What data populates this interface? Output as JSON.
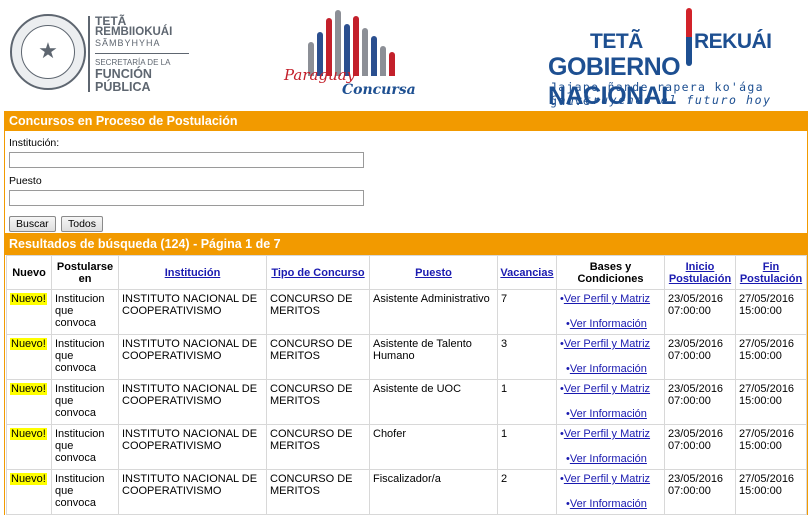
{
  "header": {
    "sfp": {
      "line1": "TETÃ",
      "line2": "REMBIIOKUÁI",
      "line3": "SÃMBYHYHA",
      "line4a": "SECRETARÍA DE LA",
      "line5": "FUNCIÓN",
      "line6": "PÚBLICA"
    },
    "concursa": {
      "word1": "Paraguay",
      "word2": "Concursa"
    },
    "gobierno": {
      "line1a": "TETÃ",
      "line1b": "REKUÁI",
      "line2": "GOBIERNO NACIONAL",
      "line3": "Jajapo ñande rapera ko'ága guive",
      "line4": "Construyendo el futuro hoy"
    },
    "colors": {
      "orange": "#f29a00",
      "red": "#d2232a",
      "blue": "#1d4f91",
      "gray": "#5e6670"
    }
  },
  "search": {
    "title": "Concursos en Proceso de Postulación",
    "institucion_label": "Institución:",
    "institucion_value": "",
    "puesto_label": "Puesto",
    "puesto_value": "",
    "buscar_label": "Buscar",
    "todos_label": "Todos"
  },
  "results": {
    "title": "Resultados de búsqueda (124) - Página 1 de 7",
    "columns": {
      "nuevo": "Nuevo",
      "postularse": "Postularse en",
      "institucion": "Institución",
      "tipo": "Tipo de Concurso",
      "puesto": "Puesto",
      "vacancias": "Vacancias",
      "bases": "Bases y Condiciones",
      "inicio": "Inicio Postulación",
      "fin": "Fin Postulación"
    },
    "rows": [
      {
        "nuevo": "Nuevo!",
        "postularse": "Institucion que convoca",
        "institucion": "INSTITUTO NACIONAL DE COOPERATIVISMO",
        "tipo": "CONCURSO DE MERITOS",
        "puesto": "Asistente Administrativo",
        "vacancias": "7",
        "link1": "Ver Perfil y Matriz",
        "link2": "Ver Información",
        "inicio": "23/05/2016 07:00:00",
        "fin": "27/05/2016 15:00:00"
      },
      {
        "nuevo": "Nuevo!",
        "postularse": "Institucion que convoca",
        "institucion": "INSTITUTO NACIONAL DE COOPERATIVISMO",
        "tipo": "CONCURSO DE MERITOS",
        "puesto": "Asistente de Talento Humano",
        "vacancias": "3",
        "link1": "Ver Perfil y Matriz",
        "link2": "Ver Información",
        "inicio": "23/05/2016 07:00:00",
        "fin": "27/05/2016 15:00:00"
      },
      {
        "nuevo": "Nuevo!",
        "postularse": "Institucion que convoca",
        "institucion": "INSTITUTO NACIONAL DE COOPERATIVISMO",
        "tipo": "CONCURSO DE MERITOS",
        "puesto": "Asistente de UOC",
        "vacancias": "1",
        "link1": "Ver Perfil y Matriz",
        "link2": "Ver Información",
        "inicio": "23/05/2016 07:00:00",
        "fin": "27/05/2016 15:00:00"
      },
      {
        "nuevo": "Nuevo!",
        "postularse": "Institucion que convoca",
        "institucion": "INSTITUTO NACIONAL DE COOPERATIVISMO",
        "tipo": "CONCURSO DE MERITOS",
        "puesto": "Chofer",
        "vacancias": "1",
        "link1": "Ver Perfil y Matriz",
        "link2": "Ver Información",
        "inicio": "23/05/2016 07:00:00",
        "fin": "27/05/2016 15:00:00"
      },
      {
        "nuevo": "Nuevo!",
        "postularse": "Institucion que convoca",
        "institucion": "INSTITUTO NACIONAL DE COOPERATIVISMO",
        "tipo": "CONCURSO DE MERITOS",
        "puesto": "Fiscalizador/a",
        "vacancias": "2",
        "link1": "Ver Perfil y Matriz",
        "link2": "Ver Información",
        "inicio": "23/05/2016 07:00:00",
        "fin": "27/05/2016 15:00:00"
      }
    ]
  }
}
